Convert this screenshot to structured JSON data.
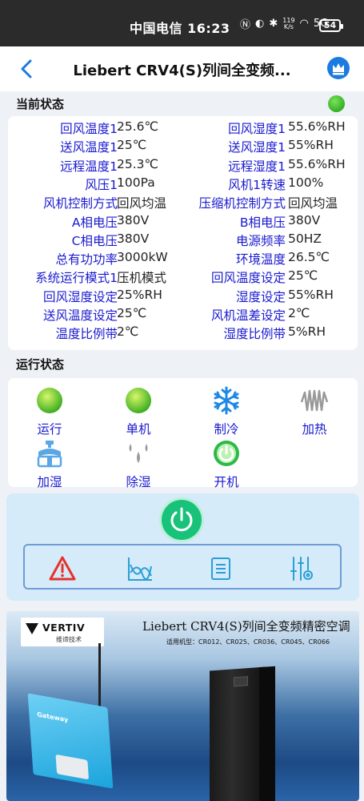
{
  "status_bar": {
    "carrier": "中国电信",
    "time": "16:23",
    "net_speed": "119\nK/s",
    "signal": "5G",
    "battery": "54"
  },
  "header": {
    "title": "Liebert CRV4(S)列间全变频..."
  },
  "current_status": {
    "title": "当前状态",
    "rows": [
      {
        "l_label": "回风温度1",
        "l_value": "25.6℃",
        "r_label": "回风湿度1",
        "r_value": "55.6%RH"
      },
      {
        "l_label": "送风温度1",
        "l_value": "25℃",
        "r_label": "送风湿度1",
        "r_value": "55%RH"
      },
      {
        "l_label": "远程温度1",
        "l_value": "25.3℃",
        "r_label": "远程湿度1",
        "r_value": "55.6%RH"
      },
      {
        "l_label": "风压1",
        "l_value": "100Pa",
        "r_label": "风机1转速",
        "r_value": "100%"
      },
      {
        "l_label": "风机控制方式",
        "l_value": "回风均温",
        "r_label": "压缩机控制方式",
        "r_value": "回风均温"
      },
      {
        "l_label": "A相电压",
        "l_value": "380V",
        "r_label": "B相电压",
        "r_value": "380V"
      },
      {
        "l_label": "C相电压",
        "l_value": "380V",
        "r_label": "电源频率",
        "r_value": "50HZ"
      },
      {
        "l_label": "总有功功率",
        "l_value": "3000kW",
        "r_label": "环境温度",
        "r_value": "26.5℃"
      },
      {
        "l_label": "系统运行模式1",
        "l_value": "压机模式",
        "r_label": "回风温度设定",
        "r_value": "25℃"
      },
      {
        "l_label": "回风湿度设定",
        "l_value": "25%RH",
        "r_label": "湿度设定",
        "r_value": "55%RH"
      },
      {
        "l_label": "送风温度设定",
        "l_value": "25℃",
        "r_label": "风机温差设定",
        "r_value": "2℃"
      },
      {
        "l_label": "温度比例带",
        "l_value": "2℃",
        "r_label": "湿度比例带",
        "r_value": "5%RH"
      }
    ],
    "indicator_color": "#3fbf2b"
  },
  "running_status": {
    "title": "运行状态",
    "items": [
      {
        "label": "运行",
        "icon": "green-dot-icon"
      },
      {
        "label": "单机",
        "icon": "green-dot-icon"
      },
      {
        "label": "制冷",
        "icon": "snowflake-icon"
      },
      {
        "label": "加热",
        "icon": "heater-icon"
      },
      {
        "label": "加湿",
        "icon": "humidifier-icon"
      },
      {
        "label": "除湿",
        "icon": "droplets-icon"
      },
      {
        "label": "开机",
        "icon": "power-on-icon"
      }
    ]
  },
  "control": {
    "power_icon": "power-icon",
    "toolbar": [
      "alarm-icon",
      "trend-chart-icon",
      "log-list-icon",
      "settings-sliders-icon"
    ]
  },
  "banner": {
    "brand": "VERTIV",
    "brand_cn": "维谛技术",
    "title": "Liebert CRV4(S)列间全变频精密空调",
    "models": "适用机型：CR012、CR025、CR036、CR045、CR066",
    "gateway_label": "Gateway"
  }
}
